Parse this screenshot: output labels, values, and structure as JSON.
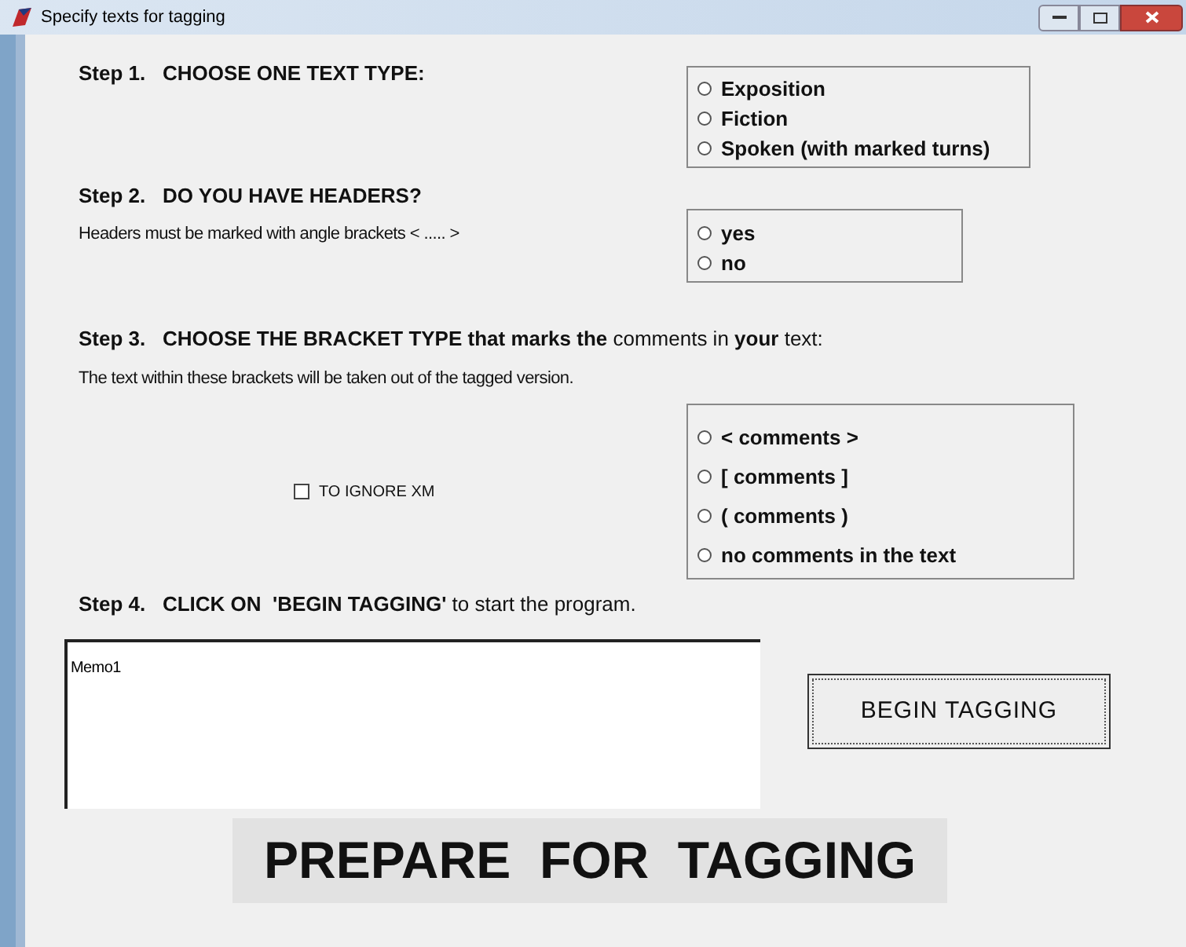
{
  "window": {
    "title": "Specify texts for tagging"
  },
  "steps": [
    {
      "heading": "**Step 1.   CHOOSE ONE TEXT TYPE:**",
      "options": [
        {
          "label": "Exposition",
          "selected": false
        },
        {
          "label": "Fiction",
          "selected": false
        },
        {
          "label": "Spoken (with marked turns)",
          "selected": false
        }
      ]
    },
    {
      "heading": "**Step 2.   DO YOU HAVE HEADERS?**",
      "note": "Headers must be marked with angle brackets < ..... >",
      "options": [
        {
          "label": "yes",
          "selected": false
        },
        {
          "label": "no",
          "selected": false
        }
      ]
    },
    {
      "heading": "**Step 3.   CHOOSE THE BRACKET TYPE that marks the** comments in **your** text:",
      "note": "The text within these brackets will be taken out of the tagged version.",
      "checkbox": {
        "label": "TO IGNORE XM",
        "checked": false
      },
      "options": [
        {
          "label": "<  comments  >",
          "selected": false
        },
        {
          "label": "[  comments  ]",
          "selected": false
        },
        {
          "label": "(  comments  )",
          "selected": false
        },
        {
          "label": "no comments in the text",
          "selected": false
        }
      ]
    }
  ],
  "step4": {
    "heading": "**Step 4.   CLICK ON  'BEGIN TAGGING'** to start the program."
  },
  "memo": {
    "value": "Memo1"
  },
  "begin_button": "BEGIN TAGGING",
  "banner": "PREPARE  FOR  TAGGING"
}
